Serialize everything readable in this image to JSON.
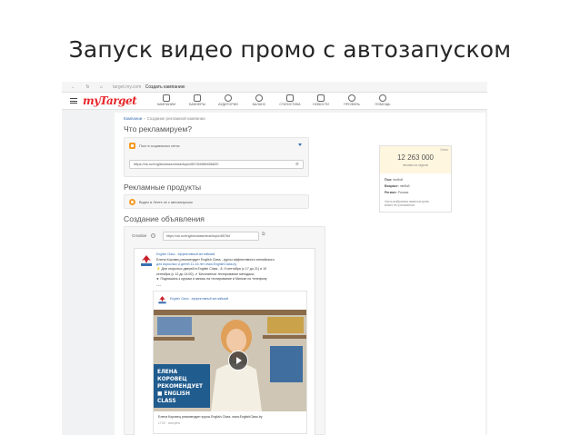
{
  "slide": {
    "title": "Запуск видео промо с автозапуском"
  },
  "browser": {
    "nav": "←  ↻  ⌂",
    "host": "target.my.com",
    "page": "Создать кампанию"
  },
  "app": {
    "logo": "myTarget",
    "nav": [
      {
        "label": "КАМПАНИИ",
        "icon": "megaphone-icon"
      },
      {
        "label": "БАННЕРЫ",
        "icon": "banner-icon"
      },
      {
        "label": "АУДИТОРИИ",
        "icon": "audience-icon"
      },
      {
        "label": "БАЛАНС",
        "icon": "balance-icon"
      },
      {
        "label": "СТАТИСТИКА",
        "icon": "statistics-icon"
      },
      {
        "label": "НОВОСТИ",
        "icon": "news-icon"
      },
      {
        "label": "ПРОФИЛЬ",
        "icon": "profile-icon"
      },
      {
        "label": "ПОМОЩЬ",
        "icon": "help-icon"
      }
    ]
  },
  "breadcrumb": {
    "link": "Кампании",
    "sep": "›",
    "current": "Создание рекламной кампании"
  },
  "what": {
    "title": "Что рекламируем?",
    "option": "Пост в социальных сетях",
    "url": "https://ok.ru/englishclassminsk/topic/65784986656820"
  },
  "products": {
    "title": "Рекламные продукты",
    "option": "Видео в Ленте ok с автозапуском"
  },
  "ad": {
    "title": "Создание объявления",
    "creative_label": "Creative",
    "creative_url": "https://ok.ru/englishclassminsk/topic/65784",
    "post": {
      "author": "English Class - эффективный английский",
      "lines": [
        "Елена Коровец рекомендует English Class - курсы эффективного английского",
        "для взрослых и детей 11-16 лет www.EnglishClass.by",
        "⚡ Дни открытых дверей в English Class - 8, 9 сентября (с 17 до 21) и 10",
        "сентября (с 12 до 14:00). ✔ Бесплатное тестирование методики;",
        "► Подпишись к курсам и запись на тестирование в Минске по телефону"
      ],
      "dots": "...",
      "inner_author": "English Class - эффективный английский",
      "banner_lines": [
        "ЕЛЕНА КОРОВЕЦ",
        "РЕКОМЕНДУЕТ",
        "■ ENGLISH CLASS"
      ],
      "caption": "Елена Коровец рекомендует курсы English Class. www.EnglishClass.by",
      "caption_time": "17:00 · смотреть"
    }
  },
  "audience": {
    "top_label": "Охват",
    "count": "12 263 000",
    "count_sub": "человек на неделю",
    "rows": [
      {
        "k": "Пол:",
        "v": "любой"
      },
      {
        "k": "Возраст:",
        "v": "любой"
      },
      {
        "k": "Регион:",
        "v": "Россия"
      }
    ],
    "note_lines": [
      "Часть выбранных вами настроек",
      "может не учитываться"
    ]
  },
  "colors": {
    "accent": "#f59a23",
    "logo": "#e8262a",
    "link": "#3a6fb0",
    "banner": "#16568c"
  }
}
